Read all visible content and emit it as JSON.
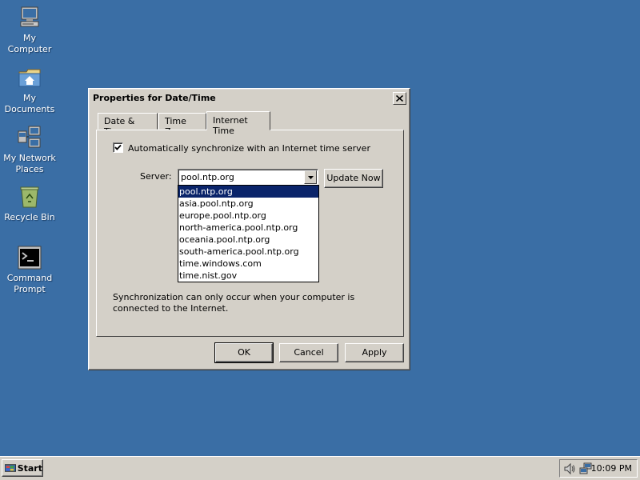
{
  "desktop": {
    "icons": [
      {
        "label_1": "My",
        "label_2": "Computer",
        "icon": "my-computer-icon"
      },
      {
        "label_1": "My",
        "label_2": "Documents",
        "icon": "my-documents-icon"
      },
      {
        "label_1": "My Network",
        "label_2": "Places",
        "icon": "network-places-icon"
      },
      {
        "label_1": "Recycle Bin",
        "label_2": "",
        "icon": "recycle-bin-icon"
      },
      {
        "label_1": "Command",
        "label_2": "Prompt",
        "icon": "command-prompt-icon"
      }
    ]
  },
  "dialog": {
    "title": "Properties for Date/Time",
    "tabs": [
      {
        "label": "Date & Time",
        "active": false
      },
      {
        "label": "Time Zone",
        "active": false
      },
      {
        "label": "Internet Time",
        "active": true
      }
    ],
    "auto_sync": {
      "checked": true,
      "label": "Automatically synchronize with an Internet time server"
    },
    "server": {
      "label": "Server:",
      "value": "pool.ntp.org",
      "options": [
        "pool.ntp.org",
        "asia.pool.ntp.org",
        "europe.pool.ntp.org",
        "north-america.pool.ntp.org",
        "oceania.pool.ntp.org",
        "south-america.pool.ntp.org",
        "time.windows.com",
        "time.nist.gov"
      ],
      "selected_index": 0
    },
    "update_now_label": "Update Now",
    "sync_note": "Synchronization can only occur when your computer is connected to the Internet.",
    "buttons": {
      "ok": "OK",
      "cancel": "Cancel",
      "apply": "Apply"
    }
  },
  "taskbar": {
    "start_label": "Start",
    "clock": "10:09 PM",
    "tray_icons": [
      "volume-icon",
      "network-icon"
    ]
  },
  "colors": {
    "desktop": "#3a6ea5",
    "face": "#d4d0c8",
    "selection": "#0a246a"
  }
}
